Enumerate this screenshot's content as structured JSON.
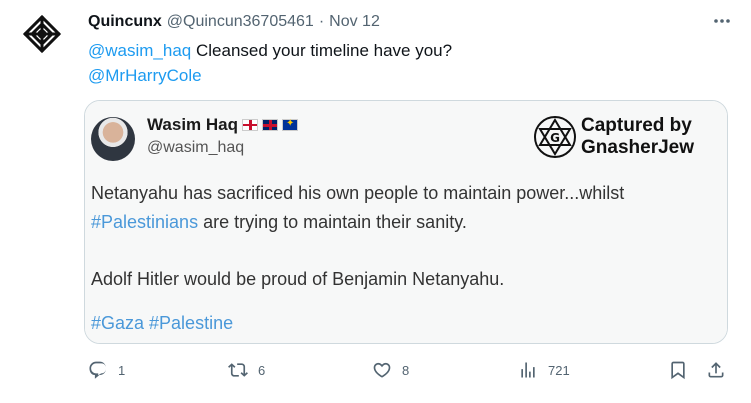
{
  "author": {
    "display_name": "Quincunx",
    "handle": "@Quincun36705461",
    "separator": "·",
    "date": "Nov 12",
    "avatar_icon": "quincunx-knot-logo-icon"
  },
  "tweet": {
    "mention_1": "@wasim_haq",
    "text": "Cleansed your timeline have you?",
    "mention_2": "@MrHarryCole"
  },
  "quoted_image": {
    "name": "Wasim Haq",
    "handle": "@wasim_haq",
    "flags": [
      "england-flag-icon",
      "uk-flag-icon",
      "eu-flag-icon"
    ],
    "watermark_line1": "Captured by",
    "watermark_line2": "GnasherJew",
    "body_line1": "Netanyahu has sacrificed his own people to maintain power...whilst",
    "hashtag_palestinians": "#Palestinians",
    "body_line2_rest": " are trying to maintain their sanity.",
    "body_line3": "Adolf Hitler would be proud of Benjamin Netanyahu.",
    "hashtags_footer": "#Gaza #Palestine"
  },
  "actions": {
    "reply_count": "1",
    "retweet_count": "6",
    "like_count": "8",
    "views_count": "721"
  },
  "colors": {
    "link": "#1d9bf0",
    "secondary_text": "#536471",
    "border": "#cfd9de"
  }
}
